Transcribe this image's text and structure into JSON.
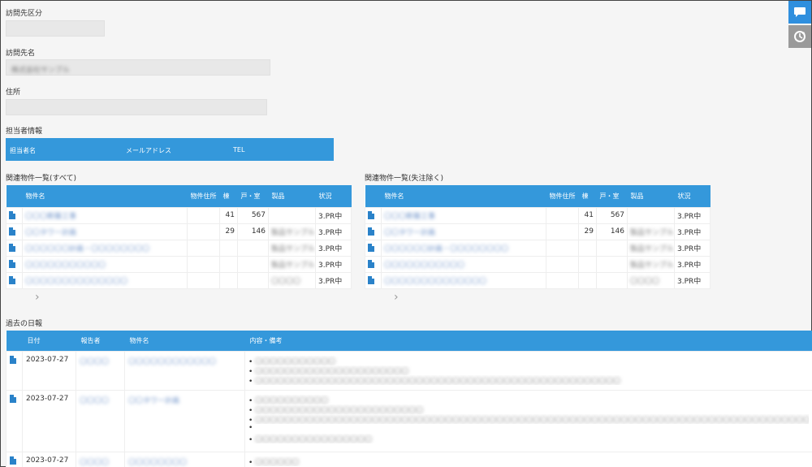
{
  "fields": {
    "visit_type_label": "訪問先区分",
    "visit_name_label": "訪問先名",
    "visit_name_value": "株式会社サンプル",
    "address_label": "住所"
  },
  "contact": {
    "section_title": "担当者情報",
    "col_name": "担当者名",
    "col_email": "メールアドレス",
    "col_tel": "TEL"
  },
  "props_all": {
    "title": "関連物件一覧(すべて)",
    "columns": [
      "物件名",
      "物件住所",
      "棟",
      "戸・室",
      "製品",
      "状況"
    ],
    "rows": [
      {
        "name": "〇〇〇新築工事",
        "address": "",
        "building": "41",
        "units": "567",
        "product": "",
        "status": "3.PR中"
      },
      {
        "name": "〇〇タワー計画",
        "address": "",
        "building": "29",
        "units": "146",
        "product": "製品サンプル",
        "status": "3.PR中"
      },
      {
        "name": "〇〇〇〇〇〇計画・〇〇〇〇〇〇〇〇",
        "address": "",
        "building": "",
        "units": "",
        "product": "製品サンプル",
        "status": "3.PR中"
      },
      {
        "name": "〇〇〇〇〇〇〇〇〇〇〇",
        "address": "",
        "building": "",
        "units": "",
        "product": "製品サンプル",
        "status": "3.PR中"
      },
      {
        "name": "〇〇〇〇〇〇〇〇〇〇〇〇〇〇",
        "address": "",
        "building": "",
        "units": "",
        "product": "〇〇〇〇",
        "status": "3.PR中"
      }
    ]
  },
  "props_excl": {
    "title": "関連物件一覧(失注除く)",
    "columns": [
      "物件名",
      "物件住所",
      "棟",
      "戸・室",
      "製品",
      "状況"
    ],
    "rows": [
      {
        "name": "〇〇〇新築工事",
        "address": "",
        "building": "41",
        "units": "567",
        "product": "",
        "status": "3.PR中"
      },
      {
        "name": "〇〇タワー計画",
        "address": "",
        "building": "29",
        "units": "146",
        "product": "製品サンプル",
        "status": "3.PR中"
      },
      {
        "name": "〇〇〇〇〇〇計画・〇〇〇〇〇〇〇〇",
        "address": "",
        "building": "",
        "units": "",
        "product": "製品サンプル",
        "status": "3.PR中"
      },
      {
        "name": "〇〇〇〇〇〇〇〇〇〇〇",
        "address": "",
        "building": "",
        "units": "",
        "product": "製品サンプル",
        "status": "3.PR中"
      },
      {
        "name": "〇〇〇〇〇〇〇〇〇〇〇〇〇〇",
        "address": "",
        "building": "",
        "units": "",
        "product": "〇〇〇〇",
        "status": "3.PR中"
      }
    ]
  },
  "reports": {
    "title": "過去の日報",
    "columns": [
      "日付",
      "報告者",
      "物件名",
      "内容・備考"
    ],
    "rows": [
      {
        "date": "2023-07-27",
        "reporter": "〇〇〇〇",
        "property": "〇〇〇〇〇〇〇〇〇〇〇〇",
        "notes": [
          "〇〇〇〇〇〇〇〇〇〇〇",
          "〇〇〇〇〇〇〇〇〇〇〇〇〇〇〇〇〇〇〇〇〇",
          "〇〇〇〇〇〇〇〇〇〇〇〇〇〇〇〇〇〇〇〇〇〇〇〇〇〇〇〇〇〇〇〇〇〇〇〇〇〇〇〇〇〇〇〇〇〇〇〇〇〇"
        ]
      },
      {
        "date": "2023-07-27",
        "reporter": "〇〇〇〇",
        "property": "〇〇タワー計画",
        "notes": [
          "〇〇〇〇〇〇〇〇〇〇",
          "〇〇〇〇〇〇〇〇〇〇〇〇〇〇〇〇〇〇〇〇〇〇〇",
          "〇〇〇〇〇〇〇〇〇〇〇〇〇〇〇〇〇〇〇〇〇〇〇〇〇〇〇〇〇〇〇〇〇〇〇〇〇〇〇〇〇〇〇〇〇〇〇〇〇〇〇〇〇〇〇〇〇〇〇〇〇〇〇〇〇〇〇〇〇〇〇〇〇〇〇〇〇〇〇",
          "",
          "〇〇〇〇〇〇〇〇〇〇〇〇〇〇〇〇"
        ]
      },
      {
        "date": "2023-07-27",
        "reporter": "〇〇〇〇",
        "property": "〇〇〇〇〇〇〇〇",
        "notes": [
          "〇〇〇〇〇〇"
        ]
      }
    ]
  },
  "icons": {
    "chat": "chat-bubble-icon",
    "history": "history-icon",
    "doc": "document-icon",
    "chevron": "chevron-right-icon"
  },
  "colors": {
    "accent": "#3498db",
    "icon_blue": "#2a82c9"
  }
}
